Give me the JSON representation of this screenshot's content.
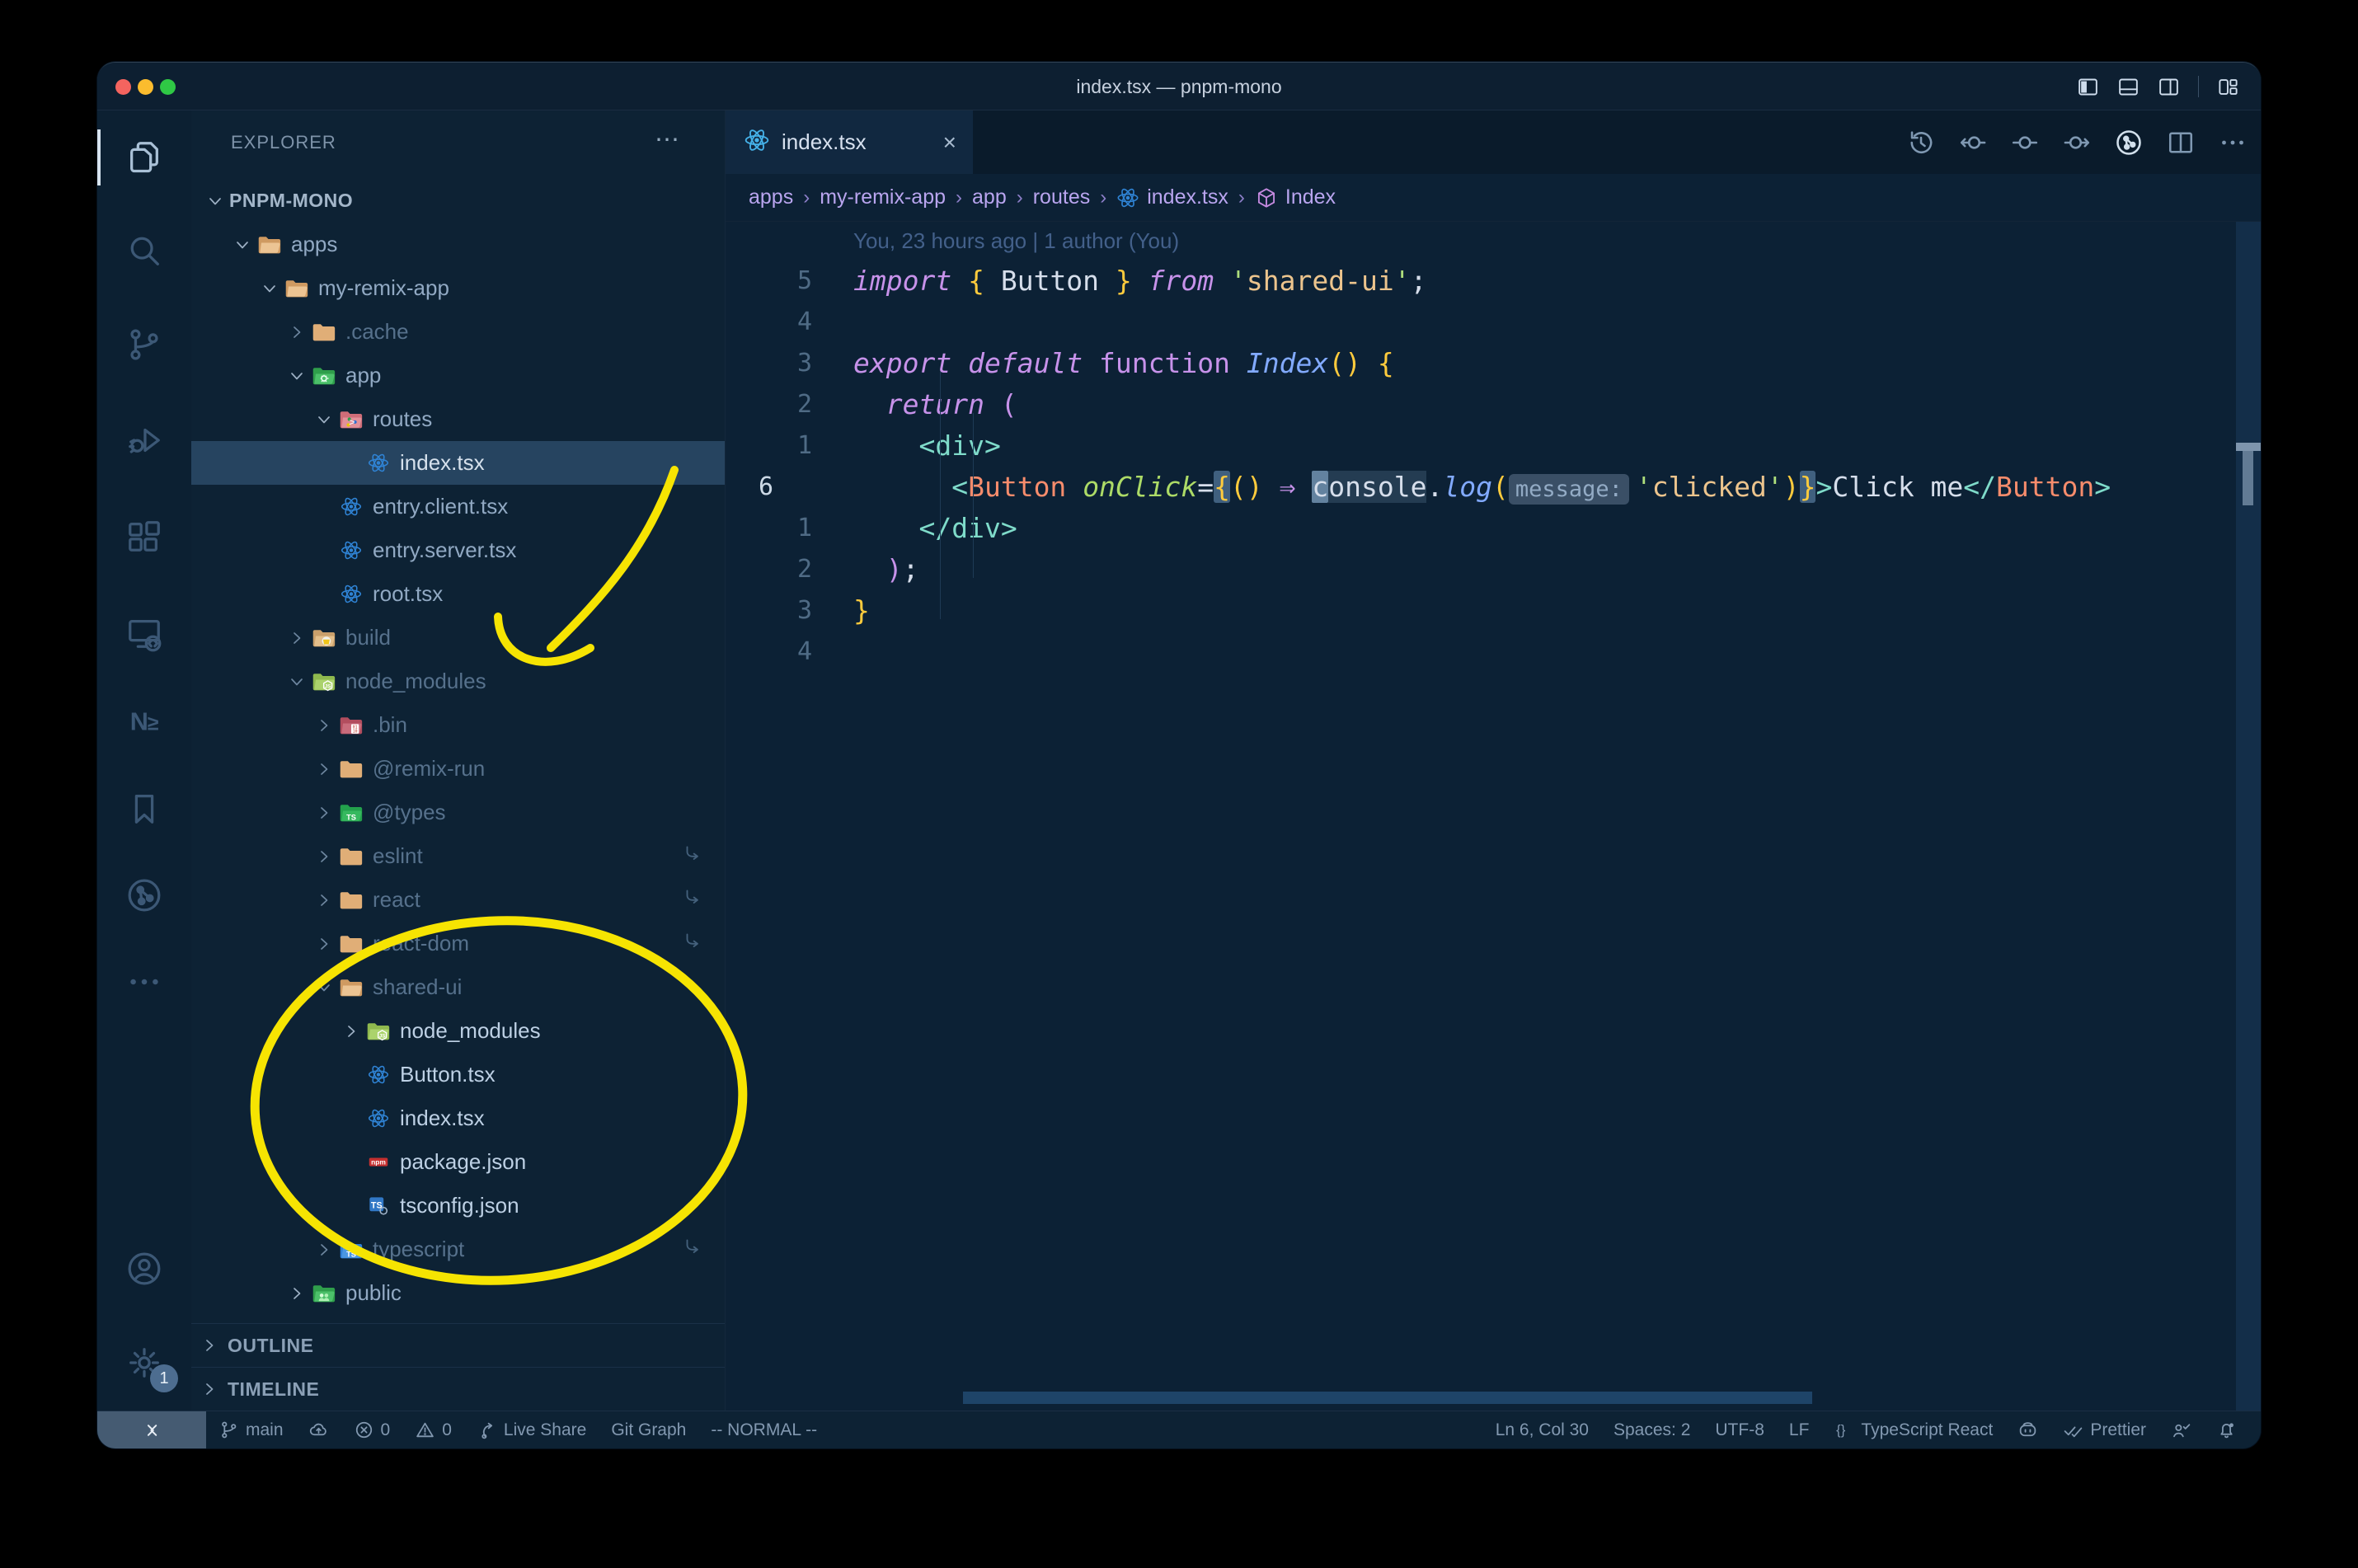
{
  "window": {
    "title": "index.tsx — pnpm-mono"
  },
  "titlebar_controls": [
    {
      "icon": "layout-sidebar-left"
    },
    {
      "icon": "layout-panel"
    },
    {
      "icon": "layout-sidebar-right"
    },
    {
      "icon": "layout-customize"
    }
  ],
  "activity_bar": {
    "items": [
      {
        "icon": "files",
        "active": true
      },
      {
        "icon": "search"
      },
      {
        "icon": "source-control"
      },
      {
        "icon": "run-debug"
      },
      {
        "icon": "extensions"
      },
      {
        "icon": "remote-explorer"
      },
      {
        "icon": "nx-console"
      },
      {
        "icon": "bookmarks"
      },
      {
        "icon": "gitlens"
      },
      {
        "icon": "more"
      }
    ],
    "bottom": [
      {
        "icon": "account"
      },
      {
        "icon": "settings",
        "badge": "1"
      }
    ]
  },
  "explorer": {
    "header": "EXPLORER",
    "tree": [
      {
        "label": "PNPM-MONO",
        "depth": 0,
        "chevron": "down",
        "icon": "none",
        "root": true
      },
      {
        "label": "apps",
        "depth": 1,
        "chevron": "down",
        "icon": "folder-open"
      },
      {
        "label": "my-remix-app",
        "depth": 2,
        "chevron": "down",
        "icon": "folder-open"
      },
      {
        "label": ".cache",
        "depth": 3,
        "chevron": "right",
        "icon": "folder",
        "dim": true
      },
      {
        "label": "app",
        "depth": 3,
        "chevron": "down",
        "icon": "folder-app"
      },
      {
        "label": "routes",
        "depth": 4,
        "chevron": "down",
        "icon": "folder-routes"
      },
      {
        "label": "index.tsx",
        "depth": 5,
        "chevron": "none",
        "icon": "react",
        "selected": true
      },
      {
        "label": "entry.client.tsx",
        "depth": 4,
        "chevron": "none",
        "icon": "react"
      },
      {
        "label": "entry.server.tsx",
        "depth": 4,
        "chevron": "none",
        "icon": "react"
      },
      {
        "label": "root.tsx",
        "depth": 4,
        "chevron": "none",
        "icon": "react"
      },
      {
        "label": "build",
        "depth": 3,
        "chevron": "right",
        "icon": "folder-build",
        "dim": true
      },
      {
        "label": "node_modules",
        "depth": 3,
        "chevron": "down",
        "icon": "folder-node",
        "dim": true
      },
      {
        "label": ".bin",
        "depth": 4,
        "chevron": "right",
        "icon": "folder-bin",
        "dim": true
      },
      {
        "label": "@remix-run",
        "depth": 4,
        "chevron": "right",
        "icon": "folder",
        "dim": true
      },
      {
        "label": "@types",
        "depth": 4,
        "chevron": "right",
        "icon": "folder-types",
        "dim": true
      },
      {
        "label": "eslint",
        "depth": 4,
        "chevron": "right",
        "icon": "folder",
        "dim": true,
        "symlink": true
      },
      {
        "label": "react",
        "depth": 4,
        "chevron": "right",
        "icon": "folder",
        "dim": true,
        "symlink": true
      },
      {
        "label": "react-dom",
        "depth": 4,
        "chevron": "right",
        "icon": "folder",
        "dim": true,
        "symlink": true
      },
      {
        "label": "shared-ui",
        "depth": 4,
        "chevron": "down",
        "icon": "folder-open",
        "dim": true,
        "symlink": true
      },
      {
        "label": "node_modules",
        "depth": 5,
        "chevron": "right",
        "icon": "folder-node",
        "bright": true
      },
      {
        "label": "Button.tsx",
        "depth": 5,
        "chevron": "none",
        "icon": "react",
        "bright": true
      },
      {
        "label": "index.tsx",
        "depth": 5,
        "chevron": "none",
        "icon": "react",
        "bright": true
      },
      {
        "label": "package.json",
        "depth": 5,
        "chevron": "none",
        "icon": "npm",
        "bright": true
      },
      {
        "label": "tsconfig.json",
        "depth": 5,
        "chevron": "none",
        "icon": "tsconfig",
        "bright": true
      },
      {
        "label": "typescript",
        "depth": 4,
        "chevron": "right",
        "icon": "folder-ts",
        "dim": true,
        "symlink": true
      },
      {
        "label": "public",
        "depth": 3,
        "chevron": "right",
        "icon": "folder-public"
      }
    ],
    "sections": [
      {
        "label": "OUTLINE"
      },
      {
        "label": "TIMELINE"
      }
    ]
  },
  "tabs": [
    {
      "label": "index.tsx",
      "icon": "react",
      "close": "×",
      "active": true
    }
  ],
  "editor_actions": [
    {
      "icon": "history"
    },
    {
      "icon": "prev-change"
    },
    {
      "icon": "change"
    },
    {
      "icon": "next-change"
    },
    {
      "icon": "gitlens-circle",
      "bright": true
    },
    {
      "icon": "split-editor"
    },
    {
      "icon": "more-horizontal"
    }
  ],
  "breadcrumbs": [
    {
      "label": "apps"
    },
    {
      "label": "my-remix-app"
    },
    {
      "label": "app"
    },
    {
      "label": "routes"
    },
    {
      "label": "index.tsx",
      "icon": "react"
    },
    {
      "label": "Index",
      "icon": "symbol-module"
    }
  ],
  "editor": {
    "blame": "You, 23 hours ago | 1 author (You)",
    "lines": [
      {
        "num": "5",
        "tokens": [
          {
            "t": "import",
            "c": "kw"
          },
          {
            "t": " ",
            "c": "w"
          },
          {
            "t": "{",
            "c": "y"
          },
          {
            "t": " Button ",
            "c": "w"
          },
          {
            "t": "}",
            "c": "y"
          },
          {
            "t": " ",
            "c": "w"
          },
          {
            "t": "from",
            "c": "kw"
          },
          {
            "t": " ",
            "c": "w"
          },
          {
            "t": "'",
            "c": "q"
          },
          {
            "t": "shared-ui",
            "c": "str"
          },
          {
            "t": "'",
            "c": "q"
          },
          {
            "t": ";",
            "c": "w"
          }
        ]
      },
      {
        "num": "4",
        "tokens": []
      },
      {
        "num": "3",
        "tokens": [
          {
            "t": "export",
            "c": "kw"
          },
          {
            "t": " ",
            "c": "w"
          },
          {
            "t": "default",
            "c": "kw"
          },
          {
            "t": " ",
            "c": "w"
          },
          {
            "t": "function",
            "c": "kwu"
          },
          {
            "t": " ",
            "c": "w"
          },
          {
            "t": "Index",
            "c": "fn"
          },
          {
            "t": "()",
            "c": "y"
          },
          {
            "t": " ",
            "c": "w"
          },
          {
            "t": "{",
            "c": "y"
          }
        ]
      },
      {
        "num": "2",
        "tokens": [
          {
            "t": "  ",
            "c": "w"
          },
          {
            "t": "return",
            "c": "kw"
          },
          {
            "t": " ",
            "c": "w"
          },
          {
            "t": "(",
            "c": "kwu"
          }
        ]
      },
      {
        "num": "1",
        "tokens": [
          {
            "t": "    ",
            "c": "w"
          },
          {
            "t": "<div>",
            "c": "tag"
          }
        ]
      },
      {
        "num": "6",
        "current": true,
        "tokens": [
          {
            "t": "      ",
            "c": "w"
          },
          {
            "t": "<",
            "c": "tag"
          },
          {
            "t": "Button",
            "c": "comp"
          },
          {
            "t": " ",
            "c": "w"
          },
          {
            "t": "onClick",
            "c": "attr"
          },
          {
            "t": "=",
            "c": "w"
          },
          {
            "t": "{",
            "c": "y",
            "box": true
          },
          {
            "t": "()",
            "c": "y"
          },
          {
            "t": " ",
            "c": "w"
          },
          {
            "t": "⇒",
            "c": "kw"
          },
          {
            "t": " ",
            "c": "w"
          },
          {
            "t": "c",
            "c": "w",
            "cursor": true
          },
          {
            "t": "onsole",
            "c": "w",
            "wordhl": true
          },
          {
            "t": ".",
            "c": "w"
          },
          {
            "t": "log",
            "c": "fn"
          },
          {
            "t": "(",
            "c": "y"
          },
          {
            "t": "message:",
            "c": "inlay"
          },
          {
            "t": "'",
            "c": "q"
          },
          {
            "t": "clicked",
            "c": "str"
          },
          {
            "t": "'",
            "c": "q"
          },
          {
            "t": ")",
            "c": "y"
          },
          {
            "t": "}",
            "c": "y",
            "box": true
          },
          {
            "t": ">",
            "c": "tag"
          },
          {
            "t": "Click me",
            "c": "w"
          },
          {
            "t": "</",
            "c": "tag"
          },
          {
            "t": "Button",
            "c": "comp"
          },
          {
            "t": ">",
            "c": "tag"
          }
        ]
      },
      {
        "num": "1",
        "tokens": [
          {
            "t": "    ",
            "c": "w"
          },
          {
            "t": "</div>",
            "c": "tag"
          }
        ]
      },
      {
        "num": "2",
        "tokens": [
          {
            "t": "  ",
            "c": "w"
          },
          {
            "t": ")",
            "c": "kwu"
          },
          {
            "t": ";",
            "c": "w"
          }
        ]
      },
      {
        "num": "3",
        "tokens": [
          {
            "t": "}",
            "c": "y"
          }
        ]
      },
      {
        "num": "4",
        "tokens": []
      }
    ]
  },
  "status_bar": {
    "left": [
      {
        "icon": "remote",
        "name": "remote-indicator"
      },
      {
        "icon": "branch",
        "label": "main",
        "name": "git-branch"
      },
      {
        "icon": "cloud-upload",
        "name": "sync"
      },
      {
        "icon": "error",
        "label": "0",
        "name": "errors"
      },
      {
        "icon": "warning",
        "label": "0",
        "name": "warnings"
      },
      {
        "icon": "live-share",
        "label": "Live Share",
        "name": "live-share"
      },
      {
        "label": "Git Graph",
        "name": "git-graph"
      },
      {
        "label": "-- NORMAL --",
        "name": "vim-mode"
      }
    ],
    "right": [
      {
        "label": "Ln 6, Col 30",
        "name": "cursor-position"
      },
      {
        "label": "Spaces: 2",
        "name": "indentation"
      },
      {
        "label": "UTF-8",
        "name": "encoding"
      },
      {
        "label": "LF",
        "name": "eol"
      },
      {
        "icon": "braces",
        "label": "TypeScript React",
        "name": "language-mode"
      },
      {
        "icon": "copilot",
        "name": "copilot"
      },
      {
        "icon": "double-check",
        "label": "Prettier",
        "name": "formatter"
      },
      {
        "icon": "feedback",
        "name": "feedback"
      },
      {
        "icon": "bell-dot",
        "name": "notifications"
      }
    ]
  },
  "annotations": {
    "color": "#f6e402"
  },
  "colors": {
    "window_bg": "#0c2236",
    "editor_bg": "#0c2135",
    "sidebar_bg": "#0d2234",
    "selection_bg": "#264460",
    "accent_yellow": "#f6e402",
    "traffic_red": "#f4645f",
    "traffic_yellow": "#fbbc2e",
    "traffic_green": "#2fc845"
  }
}
